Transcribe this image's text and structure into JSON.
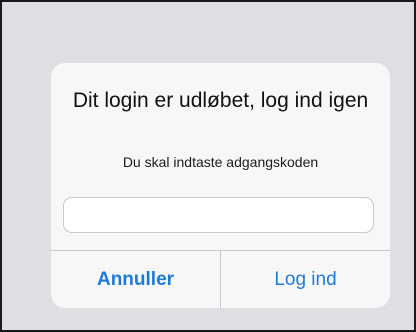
{
  "dialog": {
    "title": "Dit login er udløbet, log ind igen",
    "message": "Du skal indtaste adgangskoden",
    "password_field": {
      "value": "",
      "placeholder": ""
    },
    "buttons": {
      "cancel_label": "Annuller",
      "login_label": "Log ind"
    }
  },
  "colors": {
    "accent": "#1f7bd9",
    "backdrop": "#dedee3",
    "dialog_background": "#f7f7f8"
  }
}
